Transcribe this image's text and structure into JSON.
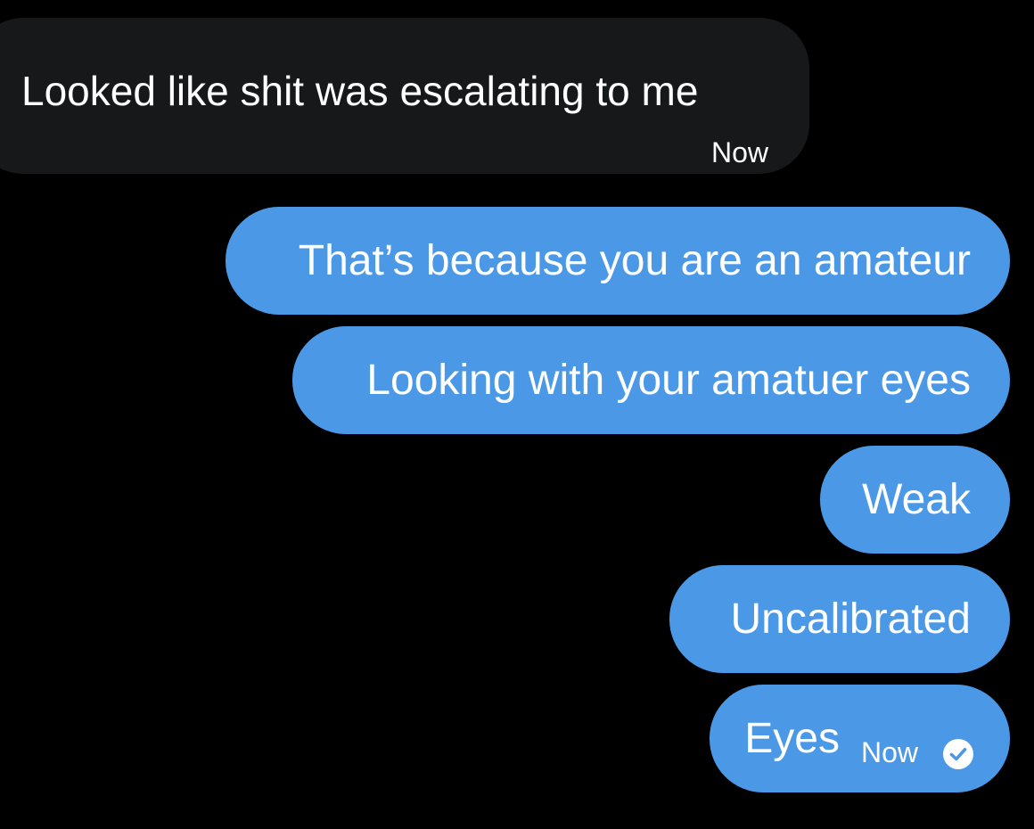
{
  "conversation": {
    "received": [
      {
        "text": "Looked like shit was escalating to me",
        "time": "Now"
      }
    ],
    "sent": [
      {
        "text": "That’s because you are an amateur"
      },
      {
        "text": "Looking with your amatuer eyes"
      },
      {
        "text": "Weak"
      },
      {
        "text": "Uncalibrated"
      },
      {
        "text": "Eyes",
        "time": "Now",
        "status_icon": "read-check-icon"
      }
    ]
  },
  "colors": {
    "background": "#000000",
    "received_bubble": "#17181a",
    "sent_bubble": "#4b99e6",
    "text": "#ffffff"
  }
}
